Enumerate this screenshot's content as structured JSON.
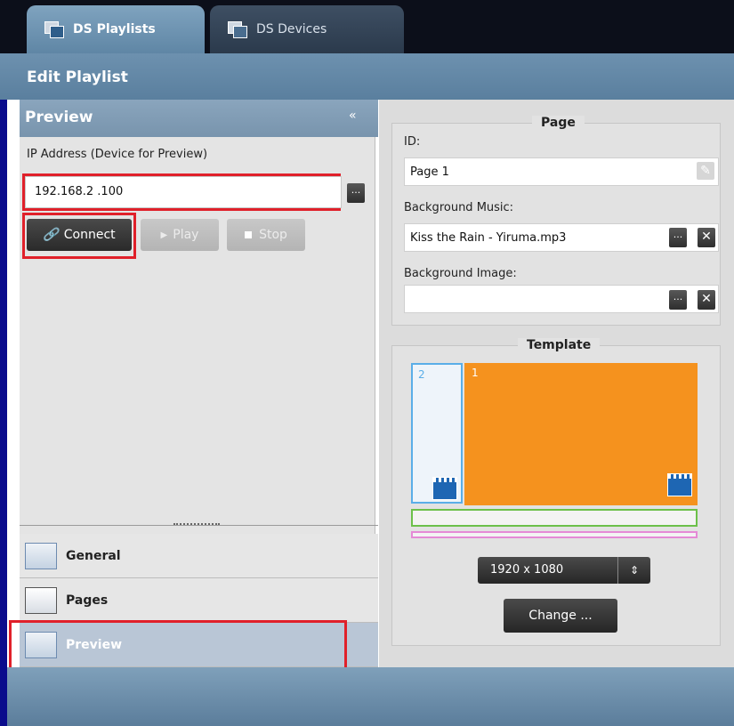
{
  "tabs": [
    {
      "label": "DS Playlists",
      "icon": "playlist-icon",
      "active": true
    },
    {
      "label": "DS Devices",
      "icon": "devices-icon",
      "active": false
    }
  ],
  "header": {
    "title": "Edit Playlist"
  },
  "preview": {
    "title": "Preview",
    "collapse_glyph": "«",
    "ip_label": "IP Address (Device for Preview)",
    "ip_value": "192.168.2 .100",
    "browse_glyph": "...",
    "connect_label": "Connect",
    "play_label": "Play",
    "stop_label": "Stop"
  },
  "nav": [
    {
      "label": "General",
      "icon": "general-icon"
    },
    {
      "label": "Pages",
      "icon": "pages-icon"
    },
    {
      "label": "Preview",
      "icon": "preview-icon",
      "active": true
    }
  ],
  "page": {
    "title": "Page",
    "id_label": "ID:",
    "id_value": "Page 1",
    "music_label": "Background Music:",
    "music_value": "Kiss the Rain - Yiruma.mp3",
    "image_label": "Background Image:",
    "image_value": "",
    "browse_glyph": "...",
    "clear_glyph": "✕"
  },
  "template": {
    "title": "Template",
    "zone_left_number": "2",
    "zone_main_number": "1",
    "resolution": "1920 x 1080",
    "change_label": "Change ..."
  },
  "colors": {
    "highlight": "#e0202a",
    "zone_main": "#f5921e",
    "zone_left_border": "#5aaee8",
    "zone_bar1": "#6cc04a",
    "zone_bar2": "#e58ad6"
  }
}
